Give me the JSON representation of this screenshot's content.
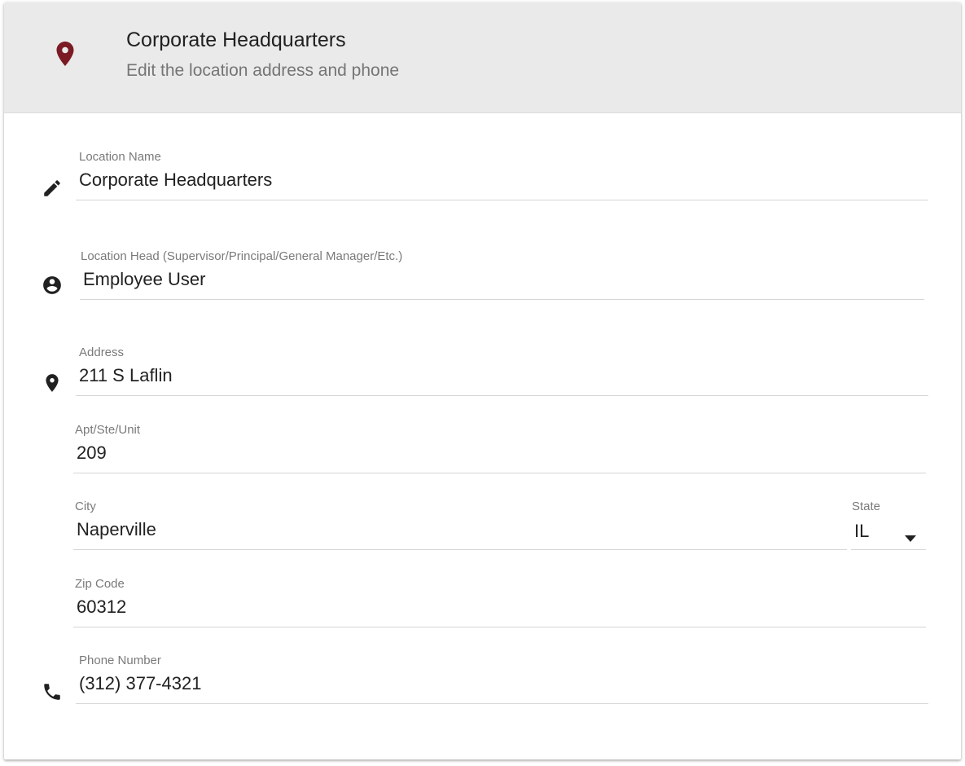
{
  "header": {
    "title": "Corporate Headquarters",
    "subtitle": "Edit the location address and phone",
    "icon": "location-pin-icon",
    "accent_color": "#7b1a24"
  },
  "form": {
    "location_name": {
      "label": "Location Name",
      "value": "Corporate Headquarters",
      "icon": "pencil-icon"
    },
    "location_head": {
      "label": "Location Head (Supervisor/Principal/General Manager/Etc.)",
      "value": "Employee User",
      "icon": "account-circle-icon"
    },
    "address": {
      "label": "Address",
      "value": "211 S Laflin",
      "icon": "location-pin-icon"
    },
    "apt": {
      "label": "Apt/Ste/Unit",
      "value": "209"
    },
    "city": {
      "label": "City",
      "value": "Naperville"
    },
    "state": {
      "label": "State",
      "value": "IL"
    },
    "zip": {
      "label": "Zip Code",
      "value": "60312"
    },
    "phone": {
      "label": "Phone Number",
      "value": "(312) 377-4321",
      "icon": "phone-icon"
    }
  }
}
